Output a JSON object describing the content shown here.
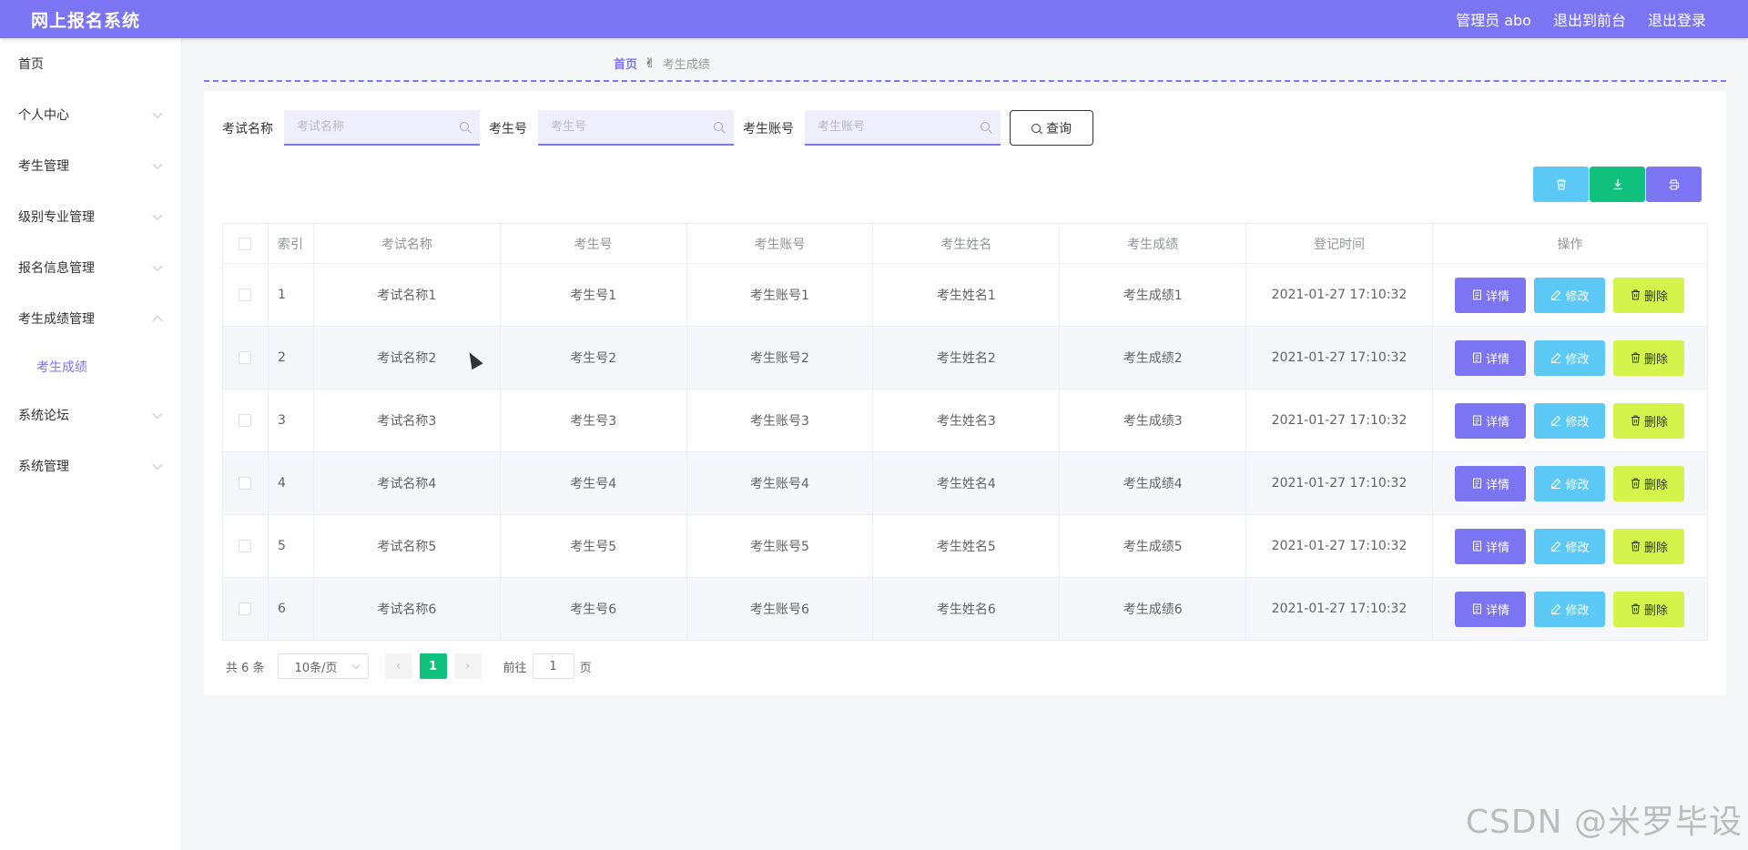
{
  "header": {
    "brand": "网上报名系统",
    "user": "管理员 abo",
    "to_front": "退出到前台",
    "logout": "退出登录",
    "color": "#7b74f3"
  },
  "sidebar": {
    "items": [
      {
        "label": "首页",
        "chevron": false
      },
      {
        "label": "个人中心",
        "chevron": "down"
      },
      {
        "label": "考生管理",
        "chevron": "down"
      },
      {
        "label": "级别专业管理",
        "chevron": "down"
      },
      {
        "label": "报名信息管理",
        "chevron": "down"
      },
      {
        "label": "考生成绩管理",
        "chevron": "up"
      },
      {
        "label": "系统论坛",
        "chevron": "down"
      },
      {
        "label": "系统管理",
        "chevron": "down"
      }
    ],
    "sub_active": "考生成绩"
  },
  "breadcrumb": {
    "home": "首页",
    "separator": "✌",
    "current": "考生成绩"
  },
  "search": {
    "exam_name_label": "考试名称",
    "exam_name_placeholder": "考试名称",
    "exam_no_label": "考生号",
    "exam_no_placeholder": "考生号",
    "account_label": "考生账号",
    "account_placeholder": "考生账号",
    "query_label": "查询"
  },
  "toolbar": {
    "delete_icon": "trash-icon",
    "download_icon": "download-icon",
    "print_icon": "print-icon"
  },
  "table": {
    "headers": [
      "索引",
      "考试名称",
      "考生号",
      "考生账号",
      "考生姓名",
      "考生成绩",
      "登记时间",
      "操作"
    ],
    "rows": [
      {
        "idx": "1",
        "exam": "考试名称1",
        "no": "考生号1",
        "account": "考生账号1",
        "name": "考生姓名1",
        "score": "考生成绩1",
        "time": "2021-01-27 17:10:32"
      },
      {
        "idx": "2",
        "exam": "考试名称2",
        "no": "考生号2",
        "account": "考生账号2",
        "name": "考生姓名2",
        "score": "考生成绩2",
        "time": "2021-01-27 17:10:32"
      },
      {
        "idx": "3",
        "exam": "考试名称3",
        "no": "考生号3",
        "account": "考生账号3",
        "name": "考生姓名3",
        "score": "考生成绩3",
        "time": "2021-01-27 17:10:32"
      },
      {
        "idx": "4",
        "exam": "考试名称4",
        "no": "考生号4",
        "account": "考生账号4",
        "name": "考生姓名4",
        "score": "考生成绩4",
        "time": "2021-01-27 17:10:32"
      },
      {
        "idx": "5",
        "exam": "考试名称5",
        "no": "考生号5",
        "account": "考生账号5",
        "name": "考生姓名5",
        "score": "考生成绩5",
        "time": "2021-01-27 17:10:32"
      },
      {
        "idx": "6",
        "exam": "考试名称6",
        "no": "考生号6",
        "account": "考生账号6",
        "name": "考生姓名6",
        "score": "考生成绩6",
        "time": "2021-01-27 17:10:32"
      }
    ],
    "actions": {
      "detail": "详情",
      "edit": "修改",
      "delete": "删除"
    }
  },
  "pagination": {
    "total": "共 6 条",
    "page_size": "10条/页",
    "current_page": "1",
    "goto_prefix": "前往",
    "goto_value": "1",
    "goto_suffix": "页"
  },
  "watermark": "CSDN @米罗毕设"
}
